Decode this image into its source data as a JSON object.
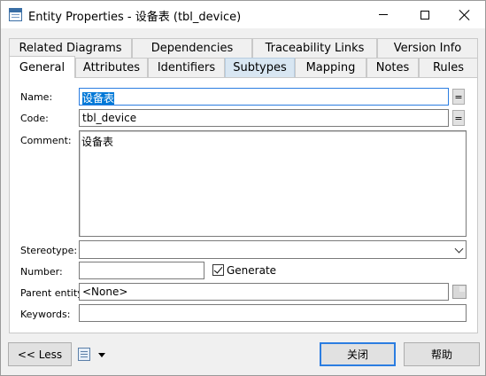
{
  "window": {
    "title": "Entity Properties - 设备表 (tbl_device)",
    "controls": {
      "minimize": "minimize",
      "maximize": "maximize",
      "close": "close"
    }
  },
  "tabs": {
    "row1": [
      "Related Diagrams",
      "Dependencies",
      "Traceability Links",
      "Version Info"
    ],
    "row2": [
      "General",
      "Attributes",
      "Identifiers",
      "Subtypes",
      "Mapping",
      "Notes",
      "Rules"
    ],
    "active": "General",
    "hovered": "Subtypes"
  },
  "form": {
    "name_label": "Name:",
    "name_value": "设备表",
    "code_label": "Code:",
    "code_value": "tbl_device",
    "equals_label": "=",
    "comment_label": "Comment:",
    "comment_value": "设备表",
    "stereotype_label": "Stereotype:",
    "stereotype_value": "",
    "number_label": "Number:",
    "number_value": "",
    "generate_label": "Generate",
    "generate_checked": true,
    "parent_label": "Parent entity:",
    "parent_value": "<None>",
    "keywords_label": "Keywords:",
    "keywords_value": ""
  },
  "footer": {
    "less_label": "<< Less",
    "close_label": "关闭",
    "help_label": "帮助"
  },
  "colors": {
    "accent": "#2b7de1",
    "selection": "#0078d7",
    "tab_hover": "#d8e6f2"
  }
}
